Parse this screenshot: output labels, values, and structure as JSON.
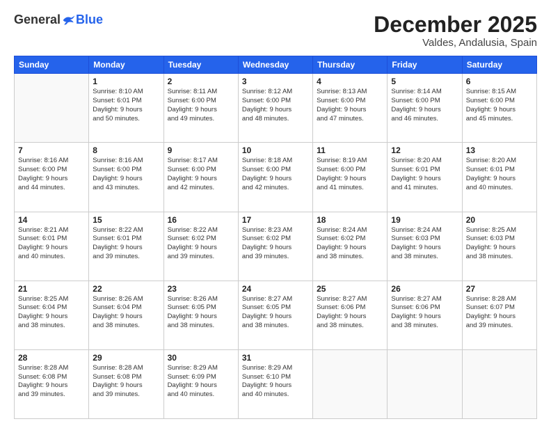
{
  "logo": {
    "general": "General",
    "blue": "Blue"
  },
  "header": {
    "month": "December 2025",
    "location": "Valdes, Andalusia, Spain"
  },
  "weekdays": [
    "Sunday",
    "Monday",
    "Tuesday",
    "Wednesday",
    "Thursday",
    "Friday",
    "Saturday"
  ],
  "weeks": [
    [
      {
        "day": "",
        "info": ""
      },
      {
        "day": "1",
        "info": "Sunrise: 8:10 AM\nSunset: 6:01 PM\nDaylight: 9 hours\nand 50 minutes."
      },
      {
        "day": "2",
        "info": "Sunrise: 8:11 AM\nSunset: 6:00 PM\nDaylight: 9 hours\nand 49 minutes."
      },
      {
        "day": "3",
        "info": "Sunrise: 8:12 AM\nSunset: 6:00 PM\nDaylight: 9 hours\nand 48 minutes."
      },
      {
        "day": "4",
        "info": "Sunrise: 8:13 AM\nSunset: 6:00 PM\nDaylight: 9 hours\nand 47 minutes."
      },
      {
        "day": "5",
        "info": "Sunrise: 8:14 AM\nSunset: 6:00 PM\nDaylight: 9 hours\nand 46 minutes."
      },
      {
        "day": "6",
        "info": "Sunrise: 8:15 AM\nSunset: 6:00 PM\nDaylight: 9 hours\nand 45 minutes."
      }
    ],
    [
      {
        "day": "7",
        "info": "Sunrise: 8:16 AM\nSunset: 6:00 PM\nDaylight: 9 hours\nand 44 minutes."
      },
      {
        "day": "8",
        "info": "Sunrise: 8:16 AM\nSunset: 6:00 PM\nDaylight: 9 hours\nand 43 minutes."
      },
      {
        "day": "9",
        "info": "Sunrise: 8:17 AM\nSunset: 6:00 PM\nDaylight: 9 hours\nand 42 minutes."
      },
      {
        "day": "10",
        "info": "Sunrise: 8:18 AM\nSunset: 6:00 PM\nDaylight: 9 hours\nand 42 minutes."
      },
      {
        "day": "11",
        "info": "Sunrise: 8:19 AM\nSunset: 6:00 PM\nDaylight: 9 hours\nand 41 minutes."
      },
      {
        "day": "12",
        "info": "Sunrise: 8:20 AM\nSunset: 6:01 PM\nDaylight: 9 hours\nand 41 minutes."
      },
      {
        "day": "13",
        "info": "Sunrise: 8:20 AM\nSunset: 6:01 PM\nDaylight: 9 hours\nand 40 minutes."
      }
    ],
    [
      {
        "day": "14",
        "info": "Sunrise: 8:21 AM\nSunset: 6:01 PM\nDaylight: 9 hours\nand 40 minutes."
      },
      {
        "day": "15",
        "info": "Sunrise: 8:22 AM\nSunset: 6:01 PM\nDaylight: 9 hours\nand 39 minutes."
      },
      {
        "day": "16",
        "info": "Sunrise: 8:22 AM\nSunset: 6:02 PM\nDaylight: 9 hours\nand 39 minutes."
      },
      {
        "day": "17",
        "info": "Sunrise: 8:23 AM\nSunset: 6:02 PM\nDaylight: 9 hours\nand 39 minutes."
      },
      {
        "day": "18",
        "info": "Sunrise: 8:24 AM\nSunset: 6:02 PM\nDaylight: 9 hours\nand 38 minutes."
      },
      {
        "day": "19",
        "info": "Sunrise: 8:24 AM\nSunset: 6:03 PM\nDaylight: 9 hours\nand 38 minutes."
      },
      {
        "day": "20",
        "info": "Sunrise: 8:25 AM\nSunset: 6:03 PM\nDaylight: 9 hours\nand 38 minutes."
      }
    ],
    [
      {
        "day": "21",
        "info": "Sunrise: 8:25 AM\nSunset: 6:04 PM\nDaylight: 9 hours\nand 38 minutes."
      },
      {
        "day": "22",
        "info": "Sunrise: 8:26 AM\nSunset: 6:04 PM\nDaylight: 9 hours\nand 38 minutes."
      },
      {
        "day": "23",
        "info": "Sunrise: 8:26 AM\nSunset: 6:05 PM\nDaylight: 9 hours\nand 38 minutes."
      },
      {
        "day": "24",
        "info": "Sunrise: 8:27 AM\nSunset: 6:05 PM\nDaylight: 9 hours\nand 38 minutes."
      },
      {
        "day": "25",
        "info": "Sunrise: 8:27 AM\nSunset: 6:06 PM\nDaylight: 9 hours\nand 38 minutes."
      },
      {
        "day": "26",
        "info": "Sunrise: 8:27 AM\nSunset: 6:06 PM\nDaylight: 9 hours\nand 38 minutes."
      },
      {
        "day": "27",
        "info": "Sunrise: 8:28 AM\nSunset: 6:07 PM\nDaylight: 9 hours\nand 39 minutes."
      }
    ],
    [
      {
        "day": "28",
        "info": "Sunrise: 8:28 AM\nSunset: 6:08 PM\nDaylight: 9 hours\nand 39 minutes."
      },
      {
        "day": "29",
        "info": "Sunrise: 8:28 AM\nSunset: 6:08 PM\nDaylight: 9 hours\nand 39 minutes."
      },
      {
        "day": "30",
        "info": "Sunrise: 8:29 AM\nSunset: 6:09 PM\nDaylight: 9 hours\nand 40 minutes."
      },
      {
        "day": "31",
        "info": "Sunrise: 8:29 AM\nSunset: 6:10 PM\nDaylight: 9 hours\nand 40 minutes."
      },
      {
        "day": "",
        "info": ""
      },
      {
        "day": "",
        "info": ""
      },
      {
        "day": "",
        "info": ""
      }
    ]
  ]
}
